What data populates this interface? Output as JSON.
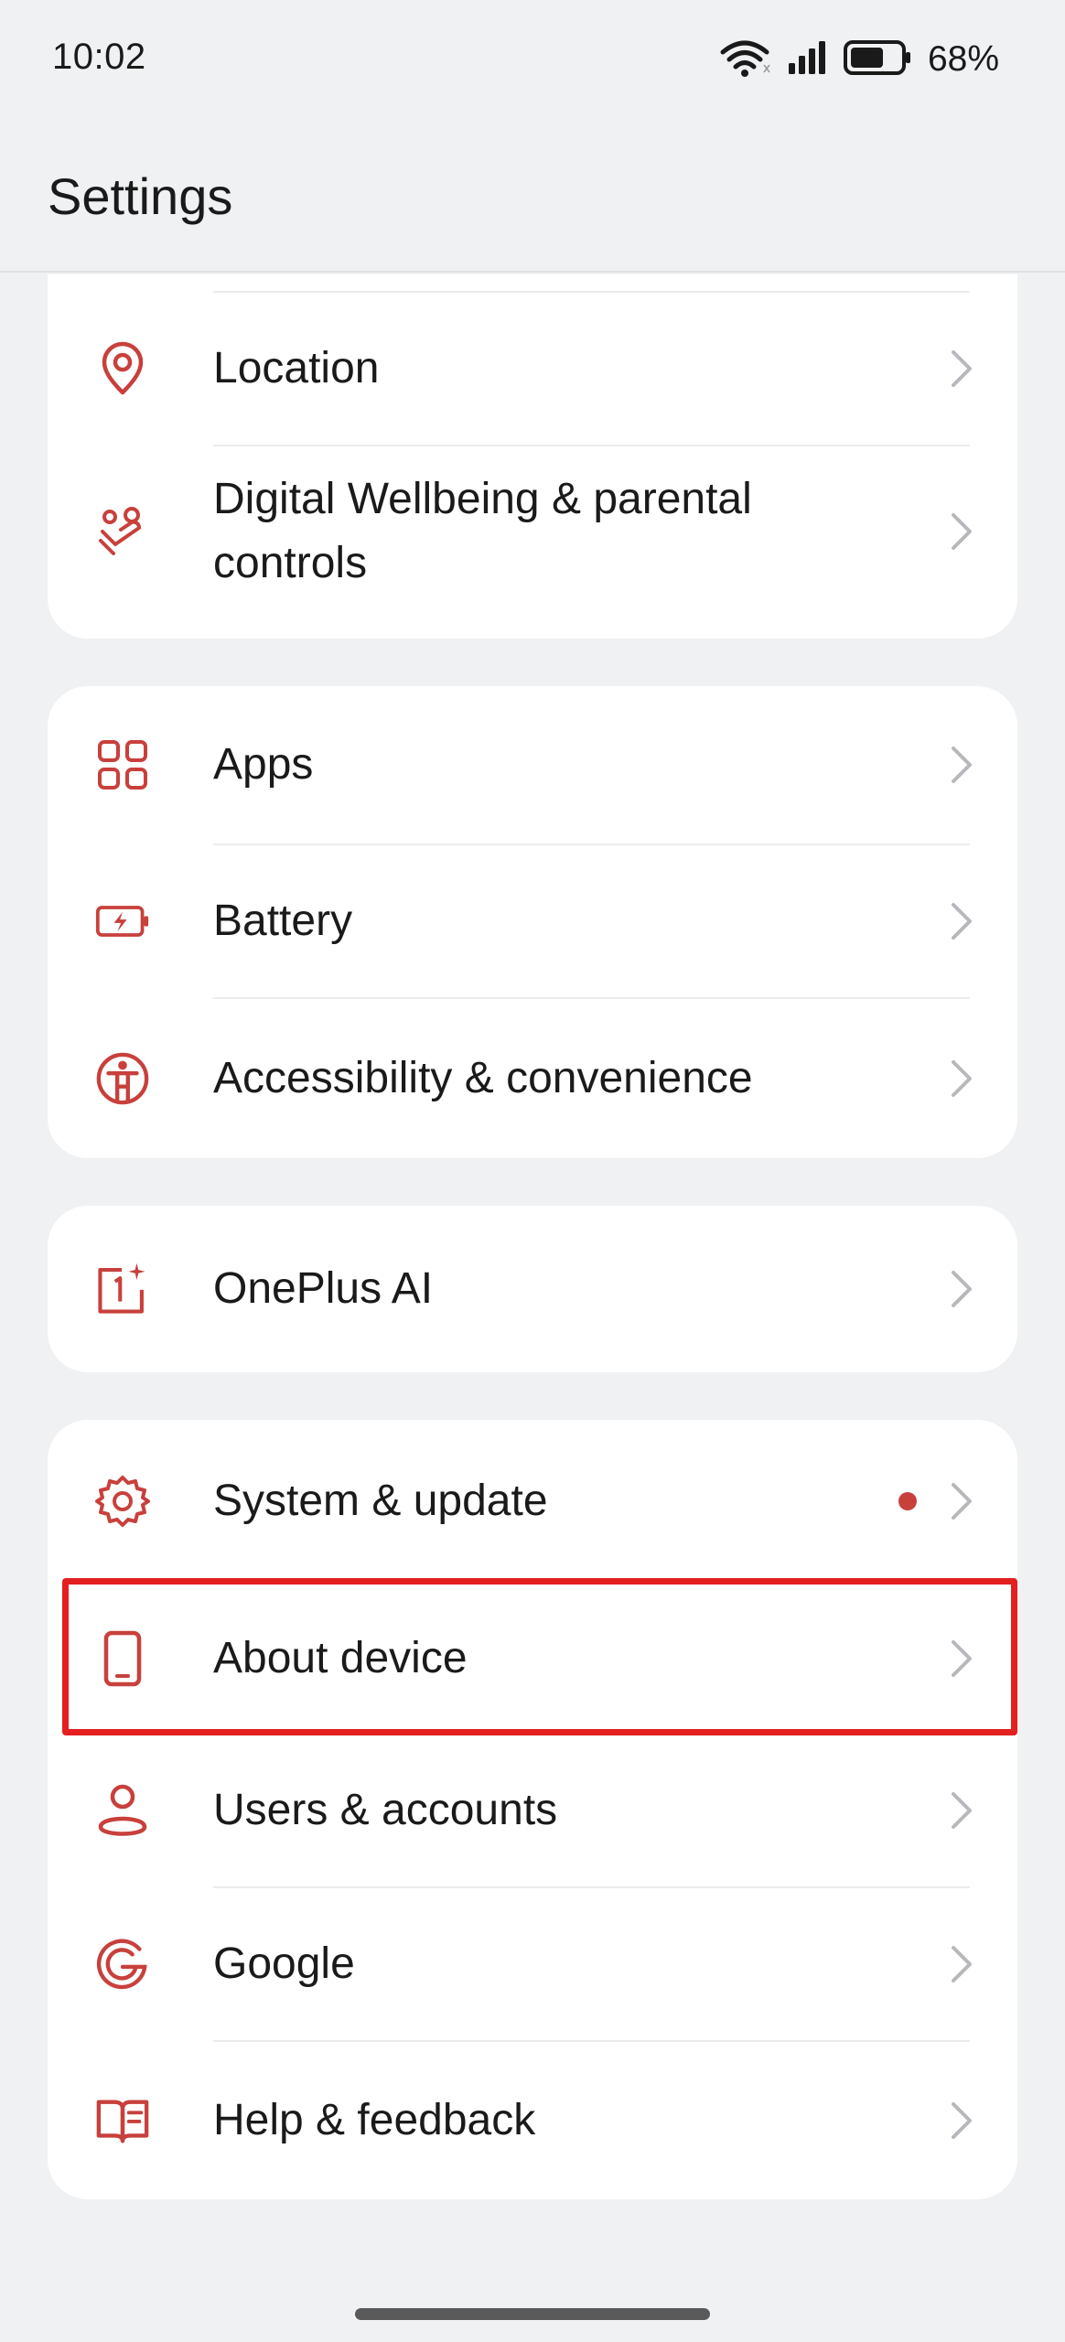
{
  "status_bar": {
    "time": "10:02",
    "battery_percent": "68%",
    "battery_level": 0.68
  },
  "header": {
    "title": "Settings"
  },
  "colors": {
    "accent": "#c8403c",
    "highlight": "#e31f1f",
    "chevron": "#b8b8bc"
  },
  "groups": [
    {
      "items": [
        {
          "label": "Location",
          "icon": "location-pin-icon"
        },
        {
          "label": "Digital Wellbeing & parental controls",
          "icon": "wellbeing-hearts-icon"
        }
      ]
    },
    {
      "items": [
        {
          "label": "Apps",
          "icon": "apps-grid-icon"
        },
        {
          "label": "Battery",
          "icon": "battery-charging-icon"
        },
        {
          "label": "Accessibility & convenience",
          "icon": "accessibility-icon"
        }
      ]
    },
    {
      "items": [
        {
          "label": "OnePlus AI",
          "icon": "oneplus-ai-icon"
        }
      ]
    },
    {
      "items": [
        {
          "label": "System & update",
          "icon": "gear-icon",
          "badge": "notification-dot"
        },
        {
          "label": "About device",
          "icon": "phone-icon",
          "highlighted": true
        },
        {
          "label": "Users & accounts",
          "icon": "user-icon"
        },
        {
          "label": "Google",
          "icon": "google-icon"
        },
        {
          "label": "Help & feedback",
          "icon": "help-book-icon"
        }
      ]
    }
  ]
}
